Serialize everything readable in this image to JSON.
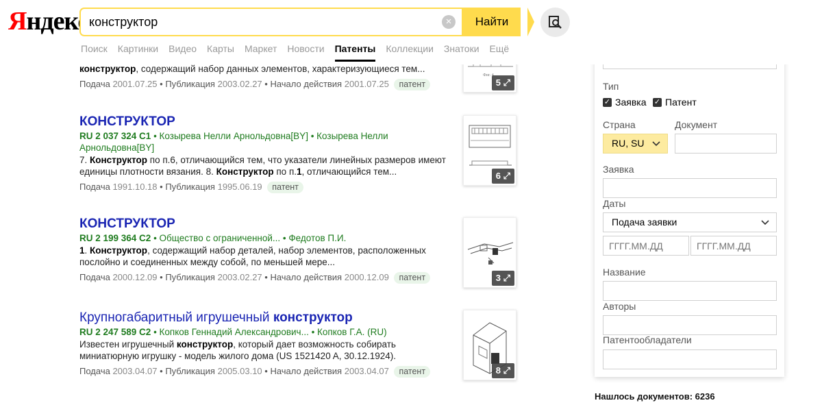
{
  "header": {
    "logo_first": "Я",
    "logo_rest": "ндекс",
    "search_value": "конструктор",
    "search_button": "Найти",
    "tabs": [
      "Поиск",
      "Картинки",
      "Видео",
      "Карты",
      "Маркет",
      "Новости",
      "Патенты",
      "Коллекции",
      "Знатоки",
      "Ещё"
    ],
    "active_tab": "Патенты"
  },
  "results": [
    {
      "snippet_bold": "конструктор",
      "snippet_rest": ", содержащий набор данных элементов, характеризующиеся тем...",
      "filing_label": "Подача",
      "filing": "2001.07.25",
      "publication_label": "Публикация",
      "publication": "2003.02.27",
      "start_label": "Начало действия",
      "start": "2001.07.25",
      "badge": "патент",
      "images": "5"
    },
    {
      "title": "КОНСТРУКТОР",
      "number": "RU 2 037 324 C1",
      "authors": " • Козырева Нелли Арнольдовна[BY] • Козырева Нелли Арнольдовна[BY]",
      "snippet_p1": "7. ",
      "snippet_b1": "Конструктор",
      "snippet_p2": " по п.6, отличающийся тем, что указатели линейных размеров имеют единицы плотности вязания. 8. ",
      "snippet_b2": "Конструктор",
      "snippet_p3": " по п.",
      "snippet_b3": "1",
      "snippet_p4": ", отличающийся тем...",
      "filing_label": "Подача",
      "filing": "1991.10.18",
      "publication_label": "Публикация",
      "publication": "1995.06.19",
      "badge": "патент",
      "images": "6"
    },
    {
      "title": "КОНСТРУКТОР",
      "number": "RU 2 199 364 C2",
      "authors": " • Общество с ограниченной... • Федотов П.И.",
      "snippet_b1": "1",
      "snippet_p1": ". ",
      "snippet_b2": "Конструктор",
      "snippet_p2": ", содержащий набор деталей, набор элементов, расположенных послойно и соединенных между собой, по меньшей мере...",
      "filing_label": "Подача",
      "filing": "2000.12.09",
      "publication_label": "Публикация",
      "publication": "2003.02.27",
      "start_label": "Начало действия",
      "start": "2000.12.09",
      "badge": "патент",
      "images": "3"
    },
    {
      "title_plain": "Крупногабаритный игрушечный ",
      "title_bold": "конструктор",
      "number": "RU 2 247 589 C2",
      "authors": " • Копков Геннадий Александрович... • Копков Г.А. (RU)",
      "snippet_p1": "Известен игрушечный ",
      "snippet_b1": "конструктор",
      "snippet_p2": ", который дает возможность собирать миниатюрную игрушку - модель жилого дома (US 1521420 A, 30.12.1924).",
      "filing_label": "Подача",
      "filing": "2003.04.07",
      "publication_label": "Публикация",
      "publication": "2005.03.10",
      "start_label": "Начало действия",
      "start": "2003.04.07",
      "badge": "патент",
      "images": "8"
    }
  ],
  "filters": {
    "type_label": "Тип",
    "type_application": "Заявка",
    "type_patent": "Патент",
    "country_label": "Страна",
    "country_value": "RU, SU",
    "document_label": "Документ",
    "application_label": "Заявка",
    "dates_label": "Даты",
    "dates_value": "Подача заявки",
    "date_placeholder": "ГГГГ.ММ.ДД",
    "name_label": "Название",
    "authors_label": "Авторы",
    "holders_label": "Патентообладатели"
  },
  "found": "Нашлось документов: 6236"
}
